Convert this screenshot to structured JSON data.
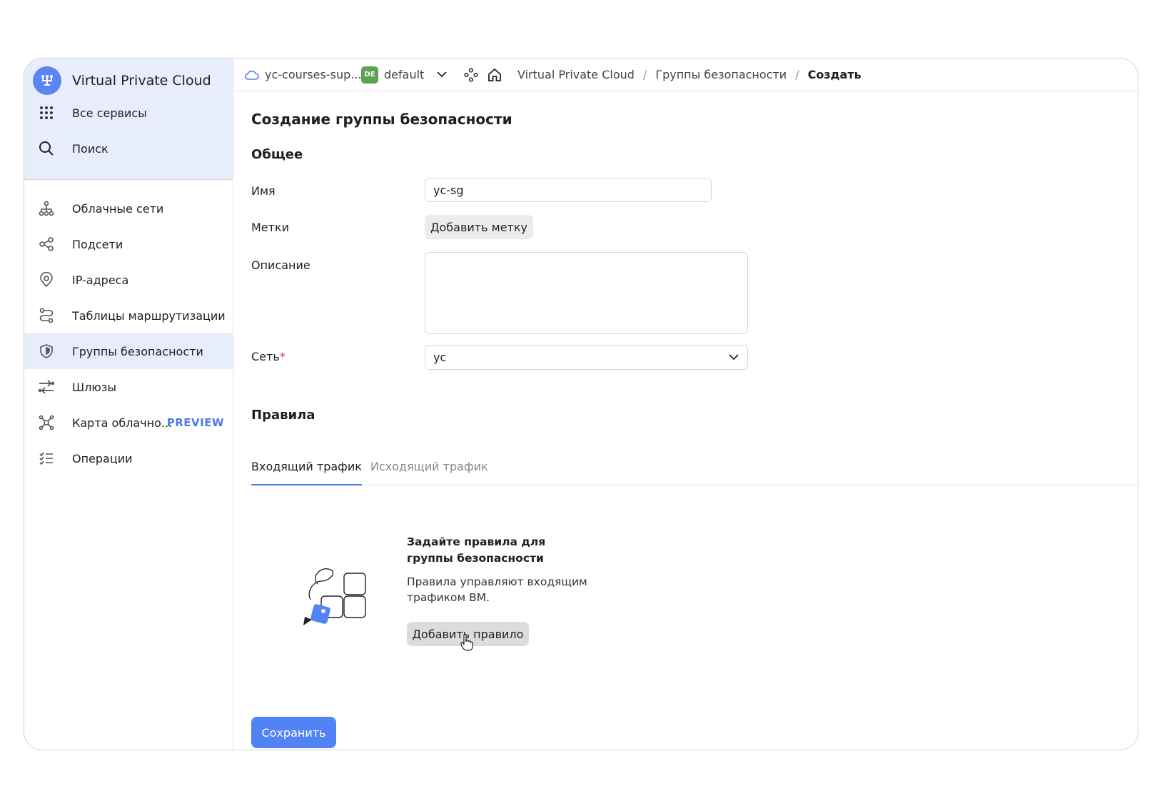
{
  "sidebar": {
    "app_title": "Virtual Private Cloud",
    "top_items": [
      {
        "label": "Все сервисы",
        "icon": "grid-icon"
      },
      {
        "label": "Поиск",
        "icon": "search-icon"
      }
    ],
    "items": [
      {
        "label": "Облачные сети",
        "icon": "network-icon"
      },
      {
        "label": "Подсети",
        "icon": "subnet-icon"
      },
      {
        "label": "IP-адреса",
        "icon": "location-pin-icon"
      },
      {
        "label": "Таблицы маршрутизации",
        "icon": "route-icon"
      },
      {
        "label": "Группы безопасности",
        "icon": "shield-icon",
        "active": true
      },
      {
        "label": "Шлюзы",
        "icon": "arrows-icon"
      },
      {
        "label": "Карта облачно...",
        "icon": "map-nodes-icon",
        "badge": "PREVIEW"
      },
      {
        "label": "Операции",
        "icon": "list-icon"
      }
    ]
  },
  "header": {
    "cloud": "yc-courses-sup...",
    "folder_badge": "DE",
    "folder": "default",
    "breadcrumbs": [
      "Virtual Private Cloud",
      "Группы безопасности",
      "Создать"
    ],
    "separator": "/"
  },
  "main": {
    "page_title": "Создание группы безопасности",
    "general_title": "Общее",
    "name_label": "Имя",
    "name_value": "yc-sg",
    "labels_label": "Метки",
    "add_label_button": "Добавить метку",
    "description_label": "Описание",
    "description_value": "",
    "network_label": "Сеть",
    "required_mark": "*",
    "network_value": "yc",
    "rules_title": "Правила",
    "tabs": [
      {
        "label": "Входящий трафик",
        "active": true
      },
      {
        "label": "Исходящий трафик",
        "active": false
      }
    ],
    "empty_title": "Задайте правила для группы безопасности",
    "empty_desc": "Правила управляют входящим трафиком ВМ.",
    "add_rule_button": "Добавить правило",
    "save_button": "Сохранить"
  },
  "colors": {
    "accent": "#5283f5",
    "sidebar_bg": "#e8edfb",
    "badge_green": "#5ea152",
    "preview": "#4b7be5"
  }
}
